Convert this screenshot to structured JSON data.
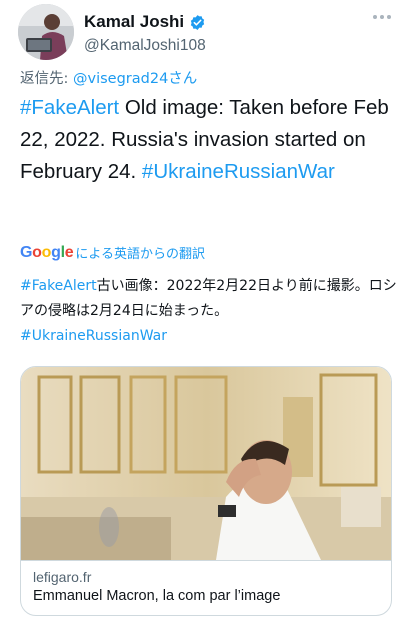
{
  "user": {
    "display_name": "Kamal Joshi",
    "handle": "@KamalJoshi108",
    "verified": true
  },
  "reply": {
    "prefix": "返信先: ",
    "mention": "@visegrad24",
    "suffix": "さん"
  },
  "tweet": {
    "hashtag1": "#FakeAlert",
    "text": " Old image: Taken before Feb 22, 2022. Russia's invasion started on February 24. ",
    "hashtag2": "#UkraineRussianWar"
  },
  "translation": {
    "google_logo": "Google",
    "label": "による英語からの翻訳",
    "hashtag1": "#FakeAlert",
    "text": "古い画像：2022年2月22日より前に撮影。ロシアの侵略は2月24日に始まった。",
    "hashtag2": "#UkraineRussianWar"
  },
  "card": {
    "domain": "lefigaro.fr",
    "title": "Emmanuel Macron, la com par l’image"
  },
  "colors": {
    "link": "#1d9bf0",
    "text": "#0f1419",
    "secondary": "#536471",
    "border": "#cfd9de"
  }
}
